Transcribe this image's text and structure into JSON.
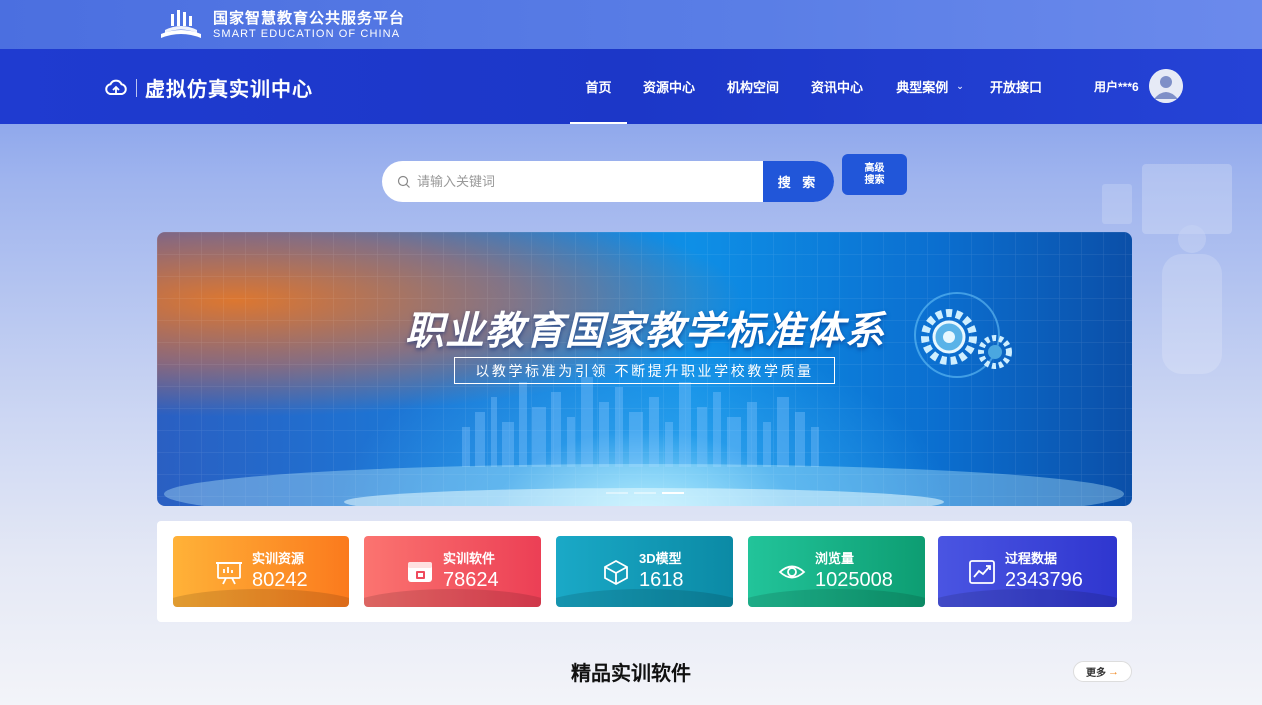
{
  "platform": {
    "name_cn": "国家智慧教育公共服务平台",
    "name_en": "SMART EDUCATION OF CHINA",
    "logo_icon": "book-logo-icon"
  },
  "header": {
    "site_title": "虚拟仿真实训中心",
    "site_icon": "cloud-icon",
    "nav": [
      {
        "label": "首页",
        "active": true
      },
      {
        "label": "资源中心",
        "active": false
      },
      {
        "label": "机构空间",
        "active": false
      },
      {
        "label": "资讯中心",
        "active": false
      },
      {
        "label": "典型案例",
        "active": false,
        "dropdown": true
      },
      {
        "label": "开放接口",
        "active": false
      }
    ],
    "dropdown_icon": "chevron-down-icon",
    "user_name": "用户***6",
    "avatar_icon": "user-avatar-icon"
  },
  "search": {
    "placeholder": "请输入关键词",
    "button_label": "搜 索",
    "advanced_line1": "高级",
    "advanced_line2": "搜索"
  },
  "banner": {
    "title": "职业教育国家教学标准体系",
    "subtitle": "以教学标准为引领 不断提升职业学校教学质量",
    "slides_total": 3,
    "slide_active": 3
  },
  "stats": [
    {
      "label": "实训资源",
      "value": "80242",
      "icon": "presentation-board-icon",
      "color_from": "#ffb238",
      "color_to": "#fb7a1d"
    },
    {
      "label": "实训软件",
      "value": "78624",
      "icon": "software-window-icon",
      "color_from": "#fb7470",
      "color_to": "#ec3f55"
    },
    {
      "label": "3D模型",
      "value": "1618",
      "icon": "cube-3d-icon",
      "color_from": "#1aa9c7",
      "color_to": "#0b8aa5"
    },
    {
      "label": "浏览量",
      "value": "1025008",
      "icon": "eye-icon",
      "color_from": "#22c49a",
      "color_to": "#0d9d72"
    },
    {
      "label": "过程数据",
      "value": "2343796",
      "icon": "line-chart-icon",
      "color_from": "#4a55e2",
      "color_to": "#2f36cf"
    }
  ],
  "section": {
    "title": "精品实训软件",
    "more_label": "更多",
    "more_icon": "arrow-right-icon"
  },
  "colors": {
    "nav_bg": "#1f3bd0",
    "topbar_bg": "#5a7ee6",
    "primary_button": "#2156d9"
  }
}
